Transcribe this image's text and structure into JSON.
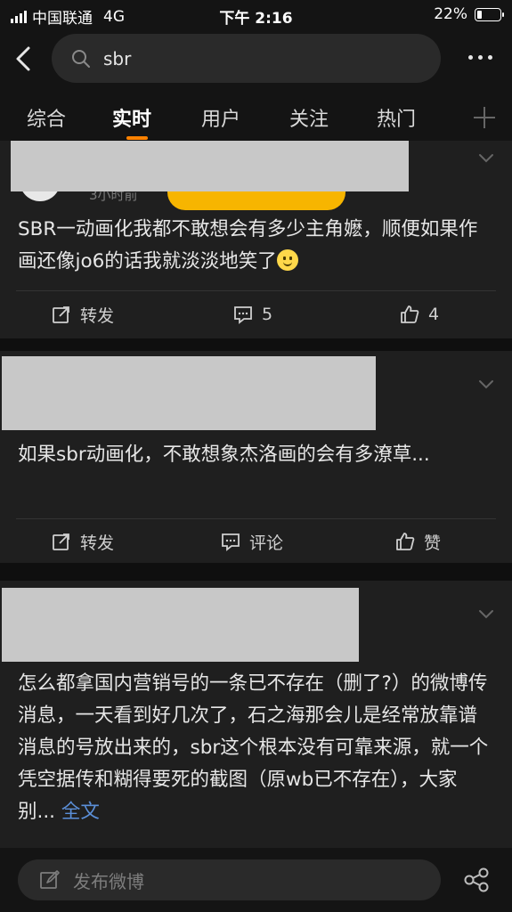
{
  "status_bar": {
    "carrier": "中国联通",
    "network": "4G",
    "time": "下午 2:16",
    "battery": "22%",
    "battery_level": 0.22
  },
  "search": {
    "query": "sbr"
  },
  "tabs": [
    {
      "label": "综合"
    },
    {
      "label": "实时",
      "active": true
    },
    {
      "label": "用户"
    },
    {
      "label": "关注"
    },
    {
      "label": "热门"
    }
  ],
  "posts": [
    {
      "time_partial": "3小时前",
      "text": "SBR一动画化我都不敢想会有多少主角嬷，顺便如果作画还像jo6的话我就淡淡地笑了",
      "repost_label": "转发",
      "comment_count": "5",
      "like_count": "4"
    },
    {
      "text": "如果sbr动画化，不敢想象杰洛画的会有多潦草...",
      "repost_label": "转发",
      "comment_label": "评论",
      "like_label": "赞"
    },
    {
      "text": "怎么都拿国内营销号的一条已不存在（删了?）的微博传消息，一天看到好几次了，石之海那会儿是经常放靠谱消息的号放出来的，sbr这个根本没有可靠来源，就一个凭空据传和糊得要死的截图（原wb已不存在），大家别...",
      "more_link": "全文"
    }
  ],
  "bottom_bar": {
    "compose_placeholder": "发布微博"
  },
  "colors": {
    "accent": "#ff8200",
    "link": "#5b8fd8",
    "badge": "#f7b500"
  }
}
